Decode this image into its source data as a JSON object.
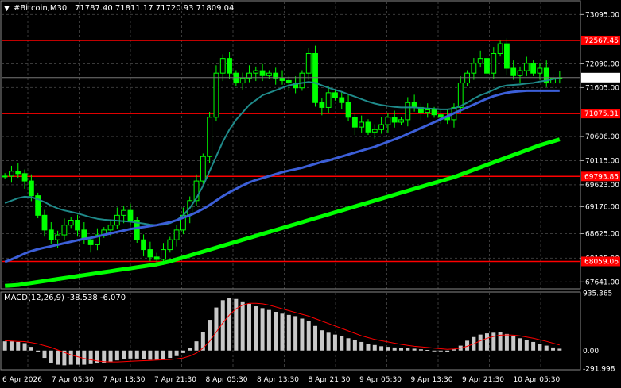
{
  "header": {
    "arrow_glyph": "▼",
    "symbol": "#Bitcoin,M30",
    "ohlc": "71787.40 71811.17 71720.93 71809.04"
  },
  "macd_header": "MACD(12,26,9) -38.538 -6.070",
  "colors": {
    "background": "#000000",
    "grid": "#3a3a3a",
    "candle": "#00ff00",
    "level_line": "#ff0000",
    "ma_fast": "#1f8a8a",
    "ma_mid": "#3c5fd8",
    "ma_slow": "#00ff00",
    "macd_hist": "#c8c8c8",
    "macd_signal": "#ff0000",
    "price_box": "#000000"
  },
  "chart_data": {
    "type": "candlestick",
    "price_ticks": [
      "73095.00",
      "72090.00",
      "71605.00",
      "70606.00",
      "70115.00",
      "69623.00",
      "69176.00",
      "68625.00",
      "68125.00",
      "67641.00"
    ],
    "price_tick_values": [
      73095,
      72090,
      71605,
      70606,
      70115,
      69623,
      69176,
      68625,
      68125,
      67641
    ],
    "ylim": [
      67500,
      73360
    ],
    "levels": [
      {
        "label": "72567.45",
        "value": 72567.45
      },
      {
        "label": "71075.31",
        "value": 71075.31
      },
      {
        "label": "69793.85",
        "value": 69793.85
      },
      {
        "label": "68059.06",
        "value": 68059.06
      }
    ],
    "current_price": {
      "label": "71809.04",
      "value": 71809.04
    },
    "time_labels": [
      "6 Apr 2026",
      "7 Apr 05:30",
      "7 Apr 13:30",
      "7 Apr 21:30",
      "8 Apr 05:30",
      "8 Apr 13:30",
      "8 Apr 21:30",
      "9 Apr 05:30",
      "9 Apr 13:30",
      "9 Apr 21:30",
      "10 Apr 05:30"
    ],
    "series_close": [
      69800,
      69900,
      69850,
      69700,
      69400,
      69000,
      68700,
      68500,
      68600,
      68800,
      68900,
      68700,
      68500,
      68400,
      68600,
      68700,
      68800,
      69000,
      69100,
      68900,
      68500,
      68300,
      68150,
      68100,
      68300,
      68500,
      68700,
      69000,
      69300,
      69700,
      70200,
      71000,
      71900,
      72200,
      71900,
      71700,
      71800,
      71900,
      71950,
      71850,
      71900,
      71800,
      71750,
      71700,
      71600,
      71900,
      72300,
      71300,
      71200,
      71500,
      71400,
      71300,
      71000,
      70800,
      70900,
      70700,
      70750,
      70850,
      71000,
      70900,
      70950,
      71300,
      71200,
      71100,
      71150,
      71050,
      71000,
      70950,
      71200,
      71700,
      71900,
      72100,
      72200,
      71900,
      72300,
      72500,
      72000,
      71850,
      71950,
      72100,
      71900,
      72000,
      71700,
      71800,
      71809
    ],
    "ma_fast_values": [
      69250,
      69300,
      69350,
      69380,
      69370,
      69330,
      69270,
      69200,
      69140,
      69100,
      69070,
      69040,
      69000,
      68960,
      68930,
      68910,
      68900,
      68890,
      68880,
      68870,
      68850,
      68830,
      68810,
      68800,
      68810,
      68840,
      68900,
      69000,
      69150,
      69350,
      69600,
      69900,
      70200,
      70500,
      70750,
      70950,
      71100,
      71250,
      71350,
      71450,
      71500,
      71550,
      71600,
      71650,
      71680,
      71700,
      71720,
      71700,
      71650,
      71600,
      71560,
      71520,
      71470,
      71420,
      71370,
      71320,
      71280,
      71250,
      71230,
      71210,
      71200,
      71200,
      71200,
      71190,
      71180,
      71170,
      71160,
      71160,
      71180,
      71230,
      71300,
      71380,
      71450,
      71500,
      71560,
      71620,
      71650,
      71660,
      71670,
      71690,
      71700,
      71730,
      71750,
      71780,
      71800
    ],
    "ma_mid_values": [
      68050,
      68100,
      68160,
      68220,
      68270,
      68310,
      68340,
      68370,
      68400,
      68430,
      68460,
      68490,
      68520,
      68540,
      68570,
      68600,
      68630,
      68660,
      68690,
      68720,
      68740,
      68760,
      68780,
      68800,
      68830,
      68860,
      68900,
      68950,
      69000,
      69060,
      69130,
      69210,
      69300,
      69390,
      69470,
      69540,
      69610,
      69670,
      69720,
      69760,
      69800,
      69840,
      69880,
      69910,
      69940,
      69970,
      70010,
      70050,
      70090,
      70120,
      70160,
      70200,
      70240,
      70280,
      70320,
      70360,
      70400,
      70450,
      70500,
      70550,
      70600,
      70660,
      70720,
      70780,
      70840,
      70900,
      70960,
      71020,
      71080,
      71140,
      71200,
      71260,
      71320,
      71380,
      71430,
      71470,
      71500,
      71520,
      71530,
      71540,
      71540,
      71540,
      71540,
      71540,
      71540
    ],
    "ma_slow_values": [
      67560,
      67570,
      67580,
      67600,
      67620,
      67640,
      67660,
      67680,
      67700,
      67720,
      67740,
      67760,
      67780,
      67800,
      67820,
      67840,
      67860,
      67880,
      67900,
      67920,
      67940,
      67960,
      67980,
      68000,
      68030,
      68060,
      68100,
      68140,
      68180,
      68220,
      68260,
      68300,
      68340,
      68380,
      68420,
      68460,
      68500,
      68540,
      68580,
      68620,
      68660,
      68700,
      68740,
      68780,
      68820,
      68860,
      68900,
      68940,
      68980,
      69020,
      69060,
      69100,
      69140,
      69180,
      69220,
      69260,
      69300,
      69340,
      69380,
      69420,
      69460,
      69500,
      69540,
      69580,
      69620,
      69660,
      69700,
      69740,
      69780,
      69830,
      69880,
      69930,
      69980,
      70030,
      70080,
      70130,
      70180,
      70230,
      70280,
      70330,
      70380,
      70430,
      70470,
      70510,
      70550
    ],
    "macd_ticks": [
      "935.365",
      "0.00",
      "-291.998"
    ],
    "macd_tick_values": [
      935.365,
      0,
      -291.998
    ],
    "macd_ylim": [
      -300,
      940
    ],
    "macd_hist": [
      150,
      150,
      140,
      120,
      60,
      -20,
      -120,
      -200,
      -230,
      -240,
      -230,
      -230,
      -230,
      -220,
      -210,
      -200,
      -180,
      -160,
      -140,
      -130,
      -130,
      -140,
      -150,
      -150,
      -140,
      -120,
      -90,
      -40,
      40,
      150,
      300,
      500,
      700,
      820,
      860,
      840,
      800,
      760,
      720,
      690,
      660,
      630,
      600,
      580,
      560,
      520,
      480,
      400,
      330,
      290,
      260,
      230,
      200,
      170,
      140,
      110,
      90,
      70,
      60,
      50,
      40,
      40,
      30,
      20,
      10,
      0,
      -10,
      -20,
      20,
      80,
      160,
      220,
      260,
      280,
      290,
      300,
      270,
      230,
      200,
      170,
      140,
      110,
      80,
      50,
      30
    ],
    "macd_signal": [
      160,
      155,
      150,
      145,
      130,
      110,
      80,
      50,
      10,
      -30,
      -70,
      -100,
      -130,
      -150,
      -170,
      -180,
      -185,
      -185,
      -180,
      -175,
      -170,
      -165,
      -160,
      -155,
      -150,
      -145,
      -135,
      -120,
      -90,
      -40,
      40,
      150,
      300,
      450,
      580,
      680,
      740,
      770,
      770,
      760,
      740,
      710,
      680,
      650,
      620,
      590,
      560,
      520,
      480,
      440,
      400,
      360,
      320,
      280,
      240,
      210,
      180,
      160,
      140,
      120,
      100,
      85,
      70,
      60,
      50,
      40,
      30,
      20,
      25,
      40,
      70,
      110,
      160,
      200,
      230,
      250,
      255,
      250,
      240,
      220,
      200,
      175,
      150,
      120,
      90
    ]
  }
}
